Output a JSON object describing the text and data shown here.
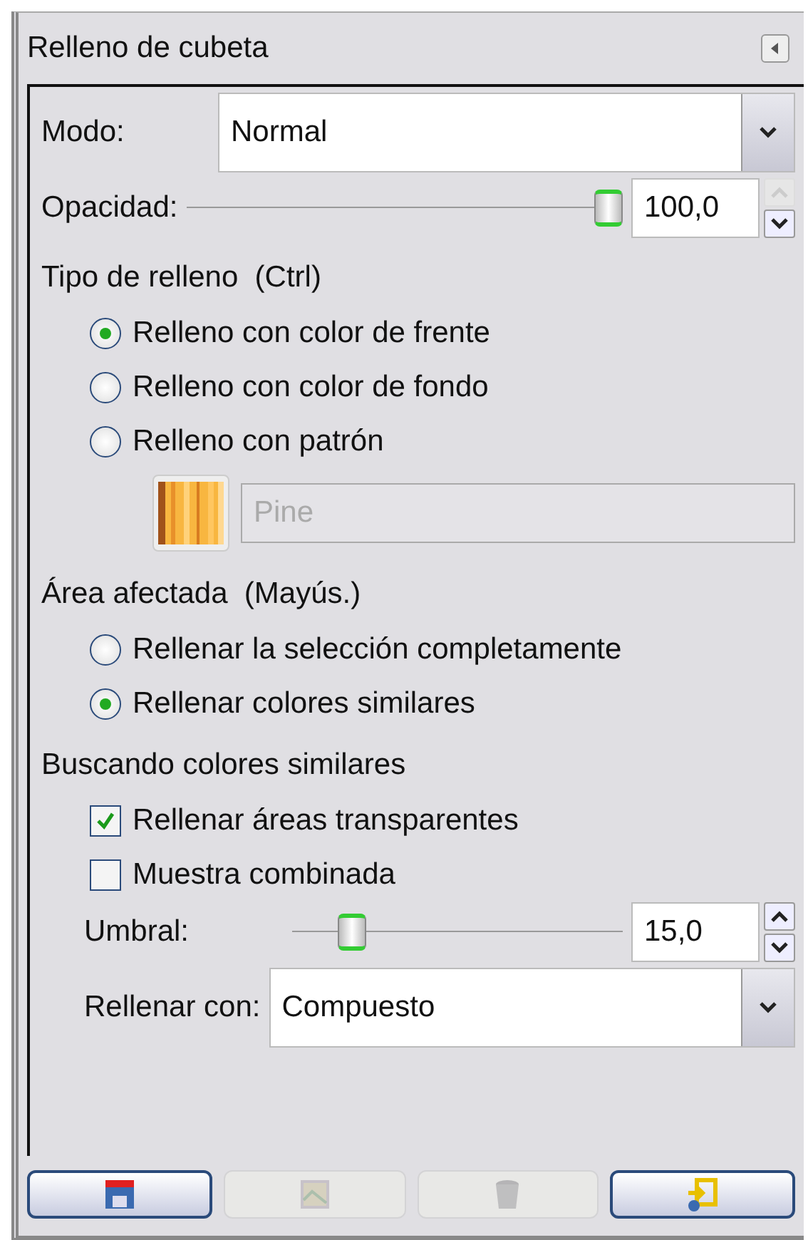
{
  "panel": {
    "title": "Relleno de cubeta"
  },
  "mode": {
    "label": "Modo:",
    "value": "Normal"
  },
  "opacity": {
    "label": "Opacidad:",
    "level": 1,
    "value": "100,0"
  },
  "fill_type": {
    "heading": "Tipo de relleno  (Ctrl)",
    "options": [
      {
        "label": "Relleno con color de frente",
        "selected": true
      },
      {
        "label": "Relleno con color de fondo",
        "selected": false
      },
      {
        "label": "Relleno con patrón",
        "selected": false
      }
    ],
    "pattern": {
      "name": "Pine",
      "disabled": true
    }
  },
  "affected_area": {
    "heading": "Área afectada  (Mayús.)",
    "options": [
      {
        "label": "Rellenar la selección completamente",
        "selected": false
      },
      {
        "label": "Rellenar colores similares",
        "selected": true
      }
    ]
  },
  "similar_colors": {
    "heading": "Buscando colores similares",
    "checkboxes": [
      {
        "label": "Rellenar áreas transparentes",
        "checked": true
      },
      {
        "label": "Muestra combinada",
        "checked": false
      }
    ],
    "threshold": {
      "label": "Umbral:",
      "level": 0.15,
      "value": "15,0"
    },
    "fill_with": {
      "label": "Rellenar con:",
      "value": "Compuesto"
    }
  },
  "buttons": [
    {
      "kind": "save",
      "disabled": false
    },
    {
      "kind": "restore",
      "disabled": true
    },
    {
      "kind": "delete",
      "disabled": true
    },
    {
      "kind": "reset",
      "disabled": false
    }
  ]
}
